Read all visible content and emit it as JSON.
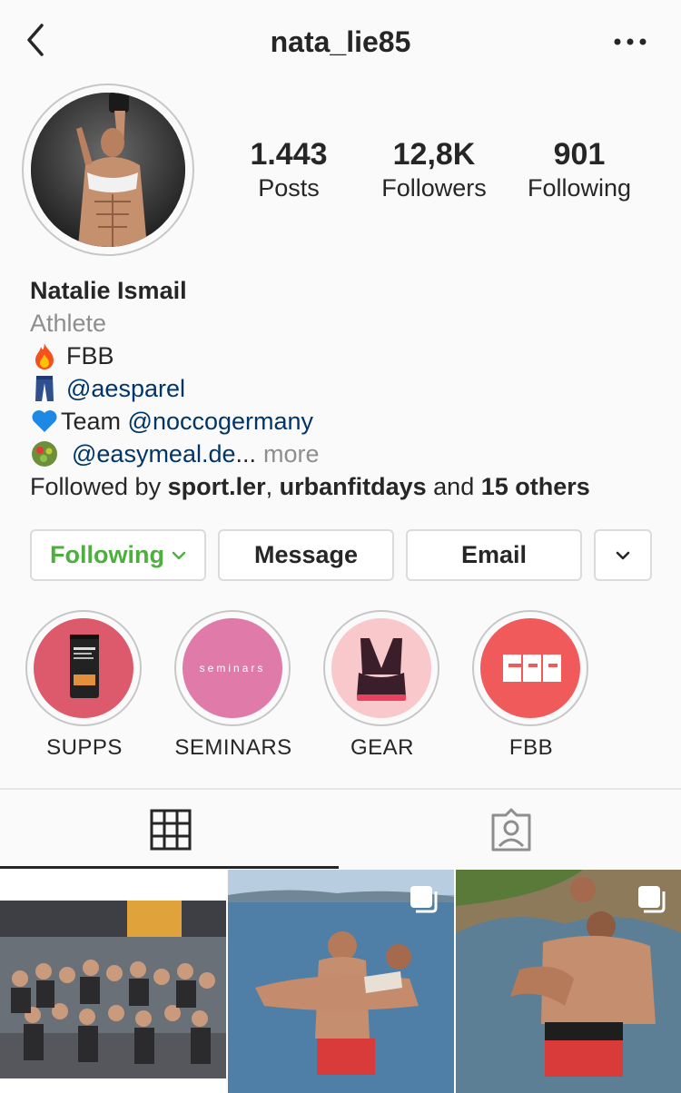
{
  "header": {
    "username": "nata_lie85",
    "back_icon": "chevron-left-icon",
    "more_icon": "more-dots-icon"
  },
  "stats": {
    "posts": {
      "value": "1.443",
      "label": "Posts"
    },
    "followers": {
      "value": "12,8K",
      "label": "Followers"
    },
    "following": {
      "value": "901",
      "label": "Following"
    }
  },
  "bio": {
    "name": "Natalie Ismail",
    "category": "Athlete",
    "lines": [
      {
        "emoji": "fire-icon",
        "text": "FBB"
      },
      {
        "emoji": "jeans-icon",
        "link": "@aesparel"
      },
      {
        "emoji": "blue-heart-icon",
        "prefix": "Team ",
        "link": "@noccogermany"
      },
      {
        "emoji": "salad-icon",
        "link": "@easymeal.de",
        "ellipsis": "...",
        "more": "more"
      }
    ],
    "followed_by": {
      "prefix": "Followed by ",
      "user1": "sport.ler",
      "sep": ", ",
      "user2": "urbanfitdays",
      "mid": " and ",
      "others": "15 others"
    }
  },
  "actions": {
    "following": "Following",
    "message": "Message",
    "email": "Email"
  },
  "highlights": [
    {
      "label": "SUPPS"
    },
    {
      "label": "SEMINARS",
      "cover_text": "seminars"
    },
    {
      "label": "GEAR"
    },
    {
      "label": "FBB"
    }
  ],
  "tabs": {
    "grid_icon": "grid-icon",
    "tagged_icon": "tagged-person-icon"
  },
  "colors": {
    "following_green": "#4caf3e",
    "link_blue": "#003569",
    "secondary_grey": "#8e8e8e",
    "supps_bg": "#dc5a6b",
    "seminars_bg": "#e07aa9",
    "gear_bg": "#f9c8cb",
    "fbb_bg": "#f05a5a"
  }
}
